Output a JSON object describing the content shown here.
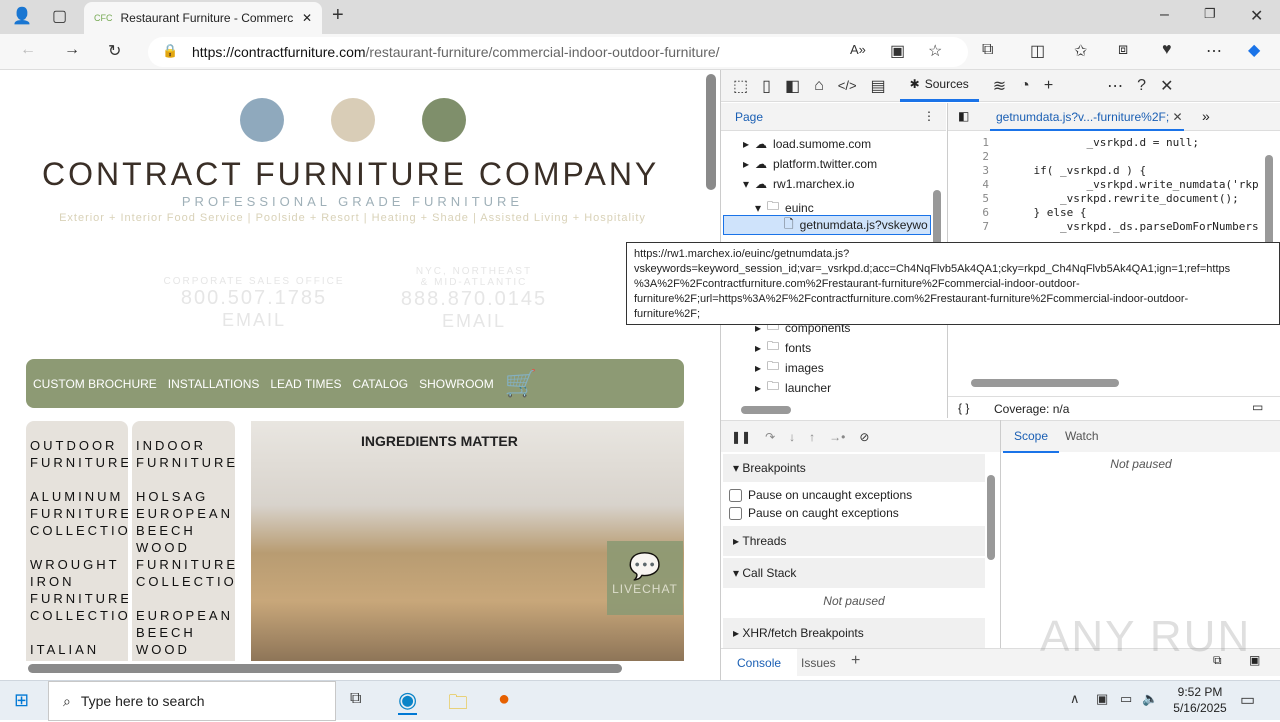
{
  "browser": {
    "tab_title": "Restaurant Furniture - Commercial",
    "new_tab": "+",
    "url_host": "https://contractfurniture.com",
    "url_path": "/restaurant-furniture/commercial-indoor-outdoor-furniture/"
  },
  "site": {
    "title": "CONTRACT FURNITURE COMPANY",
    "tagline": "PROFESSIONAL GRADE FURNITURE",
    "subtitle": "Exterior + Interior Food Service | Poolside + Resort | Heating + Shade | Assisted Living + Hospitality",
    "contacts": [
      {
        "label": "CORPORATE SALES OFFICE",
        "phone": "800.507.1785",
        "email": "EMAIL"
      },
      {
        "label": "NYC, NORTHEAST",
        "label2": "& MID-ATLANTIC",
        "phone": "888.870.0145",
        "email": "EMAIL"
      }
    ],
    "nav": [
      "CUSTOM BROCHURE",
      "INSTALLATIONS",
      "LEAD TIMES",
      "CATALOG",
      "SHOWROOM"
    ],
    "col1": [
      "OUTDOOR FURNITURE",
      "ALUMINUM FURNITURE COLLECTIONS",
      "WROUGHT IRON FURNITURE COLLECTIONS",
      "ITALIAN"
    ],
    "col2": [
      "INDOOR FURNITURE",
      "HOLSAG EUROPEAN BEECH WOOD FURNITURE COLLECTION",
      "EUROPEAN BEECH WOOD"
    ],
    "photo_sign": "INGREDIENTS MATTER",
    "livechat": "LIVECHAT",
    "accent": "#8d9a74"
  },
  "devtools": {
    "sources_tab": "Sources",
    "page_tab": "Page",
    "tree": [
      {
        "label": "load.sumome.com",
        "type": "domain"
      },
      {
        "label": "platform.twitter.com",
        "type": "domain"
      },
      {
        "label": "rw1.marchex.io",
        "type": "domain"
      },
      {
        "label": "euinc",
        "type": "folder"
      },
      {
        "label": "getnumdata.js?vskeywo",
        "type": "file"
      },
      {
        "label": "components",
        "type": "folder"
      },
      {
        "label": "fonts",
        "type": "folder"
      },
      {
        "label": "images",
        "type": "folder"
      },
      {
        "label": "launcher",
        "type": "folder"
      }
    ],
    "file_tab": "getnumdata.js?v...-furniture%2F;",
    "code": [
      "1",
      "            _vsrkpd.d = null;",
      "2",
      "",
      "3",
      "    if( _vsrkpd.d ) {",
      "4",
      "            _vsrkpd.write_numdata('rkpd_",
      "5",
      "        _vsrkpd.rewrite_document();",
      "6",
      "    } else {",
      "7",
      "        _vsrkpd._ds.parseDomForNumbers()."
    ],
    "coverage": "Coverage: n/a",
    "braces": "{ }",
    "tooltip": "https://rw1.marchex.io/euinc/getnumdata.js?\nvskeywords=keyword_session_id;var=_vsrkpd.d;acc=Ch4NqFlvb5Ak4QA1;cky=rkpd_Ch4NqFlvb5Ak4QA1;ign=1;ref=https\n%3A%2F%2Fcontractfurniture.com%2Frestaurant-furniture%2Fcommercial-indoor-outdoor-\nfurniture%2F;url=https%3A%2F%2Fcontractfurniture.com%2Frestaurant-furniture%2Fcommercial-indoor-outdoor-\nfurniture%2F;",
    "breakpoints": "Breakpoints",
    "pause_uncaught": "Pause on uncaught exceptions",
    "pause_caught": "Pause on caught exceptions",
    "threads": "Threads",
    "call_stack": "Call Stack",
    "not_paused": "Not paused",
    "xhr": "XHR/fetch Breakpoints",
    "scope": "Scope",
    "watch": "Watch",
    "console": "Console",
    "issues": "Issues"
  },
  "taskbar": {
    "search_placeholder": "Type here to search",
    "time": "9:52 PM",
    "date": "5/16/2025"
  },
  "watermark": "ANY RUN"
}
